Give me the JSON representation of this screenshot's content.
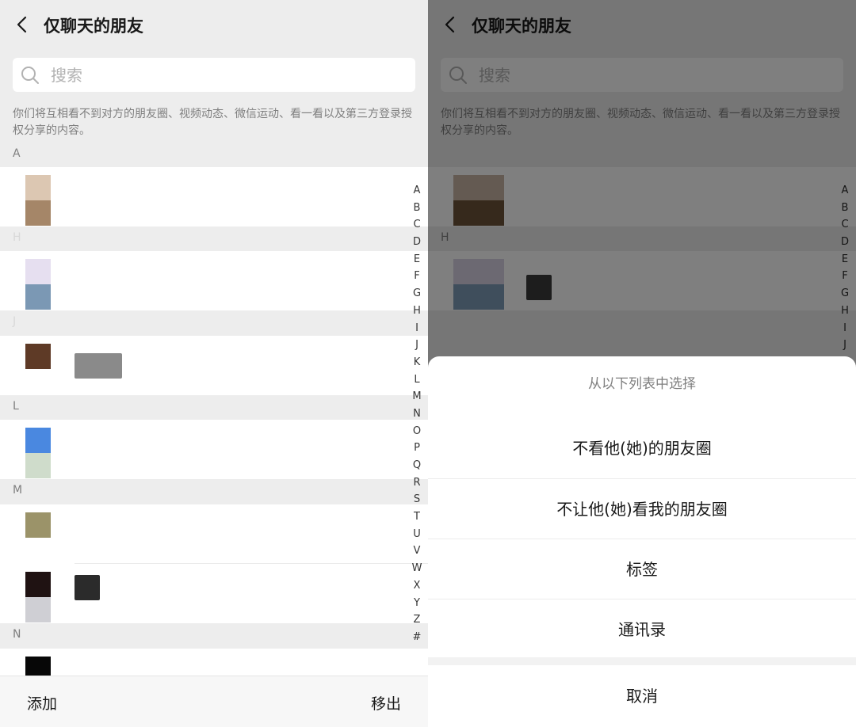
{
  "left": {
    "header": {
      "title": "仅聊天的朋友"
    },
    "search": {
      "placeholder": "搜索"
    },
    "description": "你们将互相看不到对方的朋友圈、视频动态、微信运动、看一看以及第三方登录授权分享的内容。",
    "sections": [
      {
        "letter": "A"
      },
      {
        "letter": "H"
      },
      {
        "letter": "J"
      },
      {
        "letter": "L"
      },
      {
        "letter": "M"
      },
      {
        "letter": "N"
      }
    ],
    "index_letters": [
      "A",
      "B",
      "C",
      "D",
      "E",
      "F",
      "G",
      "H",
      "I",
      "J",
      "K",
      "L",
      "M",
      "N",
      "O",
      "P",
      "Q",
      "R",
      "S",
      "T",
      "U",
      "V",
      "W",
      "X",
      "Y",
      "Z",
      "#"
    ],
    "footer": {
      "add_label": "添加",
      "remove_label": "移出"
    }
  },
  "right": {
    "header": {
      "title": "仅聊天的朋友"
    },
    "search": {
      "placeholder": "搜索"
    },
    "description": "你们将互相看不到对方的朋友圈、视频动态、微信运动、看一看以及第三方登录授权分享的内容。",
    "section_h": "H",
    "index_letters": [
      "A",
      "B",
      "C",
      "D",
      "E",
      "F",
      "G",
      "H",
      "I",
      "J"
    ],
    "action_sheet": {
      "title": "从以下列表中选择",
      "items": [
        "不看他(她)的朋友圈",
        "不让他(她)看我的朋友圈",
        "标签",
        "通讯录"
      ],
      "cancel": "取消"
    }
  },
  "colors": {
    "background": "#ededed",
    "row": "#ffffff",
    "text_primary": "#191919",
    "text_secondary": "#7f7f7f"
  }
}
